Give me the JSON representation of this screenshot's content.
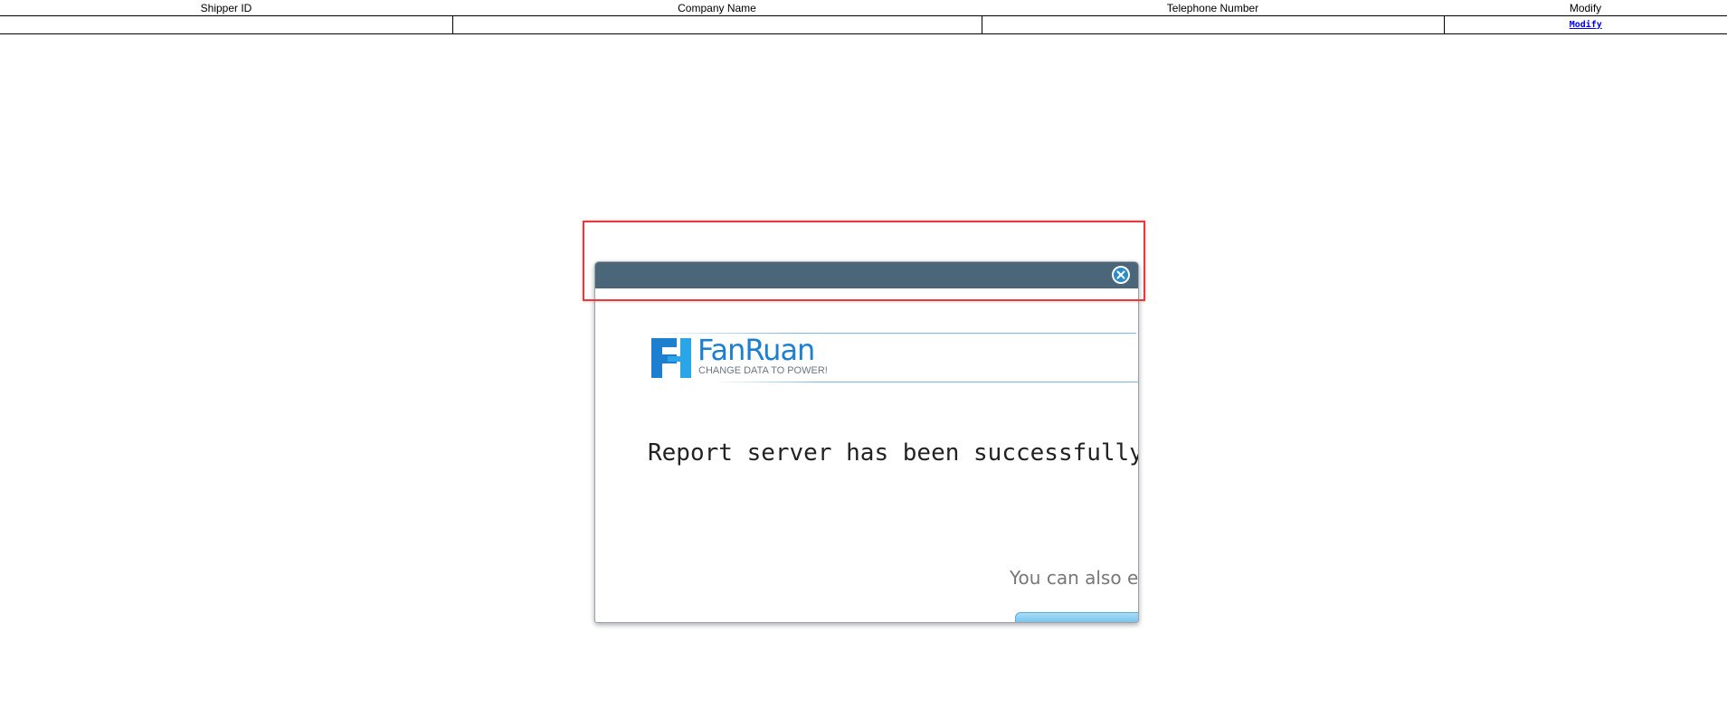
{
  "table": {
    "headers": [
      "Shipper ID",
      "Company Name",
      "Telephone Number",
      "Modify"
    ],
    "rows": [
      {
        "shipper_id": "",
        "company_name": "",
        "telephone": "",
        "modify_link": "Modify"
      }
    ]
  },
  "dialog": {
    "brand_name": "FanRuan",
    "brand_tagline": "CHANGE DATA TO POWER!",
    "message": "Report server has been successfully",
    "subtext": "You can also e",
    "colors": {
      "titlebar": "#4b6579",
      "brand": "#1c7fcf",
      "close_icon": "#2d8cc8",
      "highlight": "#e8393b"
    },
    "icons": {
      "close": "close-icon",
      "logo": "fanruan-logo-icon"
    }
  }
}
